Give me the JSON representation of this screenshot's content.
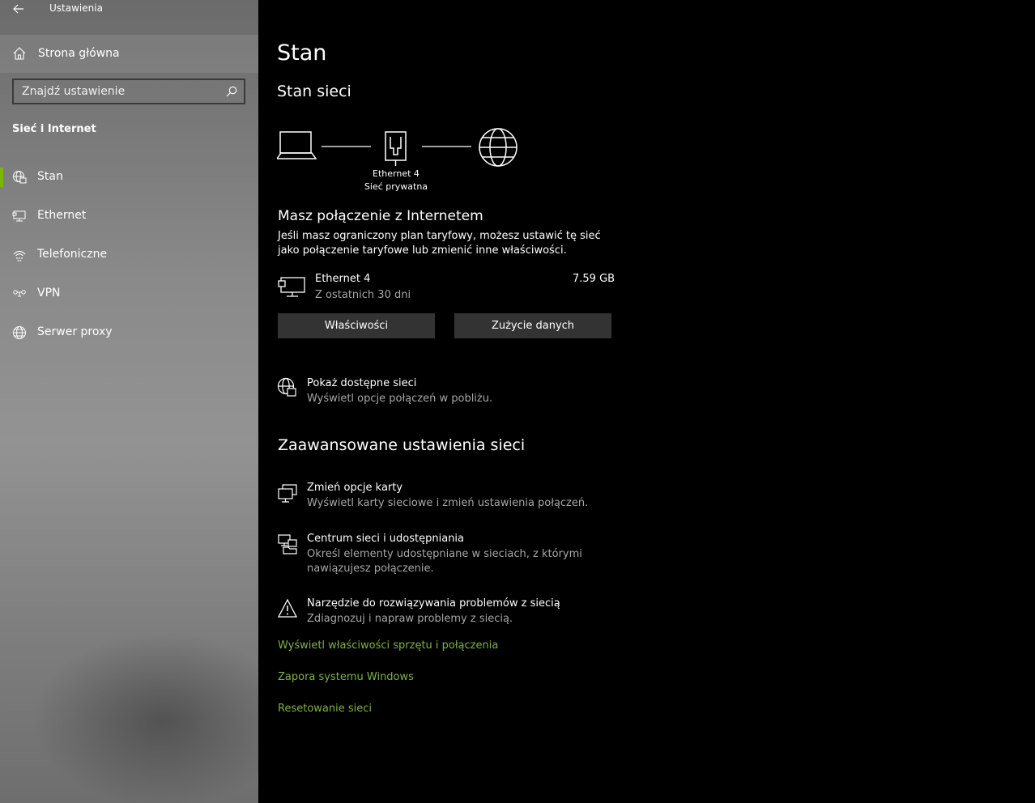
{
  "window": {
    "title": "Ustawienia"
  },
  "sidebar": {
    "home_label": "Strona główna",
    "search_placeholder": "Znajdź ustawienie",
    "section_title": "Sieć i Internet",
    "items": [
      {
        "label": "Stan",
        "icon": "status-globe-icon",
        "active": true
      },
      {
        "label": "Ethernet",
        "icon": "ethernet-monitor-icon",
        "active": false
      },
      {
        "label": "Telefoniczne",
        "icon": "dialup-icon",
        "active": false
      },
      {
        "label": "VPN",
        "icon": "vpn-icon",
        "active": false
      },
      {
        "label": "Serwer proxy",
        "icon": "globe-icon",
        "active": false
      }
    ],
    "accent_color": "#76b900"
  },
  "main": {
    "title": "Stan",
    "subtitle": "Stan sieci",
    "diagram": {
      "adapter_name": "Ethernet 4",
      "network_type": "Sieć prywatna"
    },
    "connection_heading": "Masz połączenie z Internetem",
    "connection_desc": "Jeśli masz ograniczony plan taryfowy, możesz ustawić tę sieć jako połączenie taryfowe lub zmienić inne właściwości.",
    "adapter": {
      "name": "Ethernet 4",
      "period": "Z ostatnich 30 dni",
      "usage": "7.59 GB"
    },
    "buttons": {
      "properties": "Właściwości",
      "data_usage": "Zużycie danych"
    },
    "show_networks": {
      "title": "Pokaż dostępne sieci",
      "desc": "Wyświetl opcje połączeń w pobliżu."
    },
    "advanced_heading": "Zaawansowane ustawienia sieci",
    "advanced_items": [
      {
        "title": "Zmień opcje karty",
        "desc": "Wyświetl karty sieciowe i zmień ustawienia połączeń."
      },
      {
        "title": "Centrum sieci i udostępniania",
        "desc": "Określ elementy udostępniane w sieciach, z którymi nawiązujesz połączenie."
      },
      {
        "title": "Narzędzie do rozwiązywania problemów z siecią",
        "desc": "Zdiagnozuj i napraw problemy z siecią."
      }
    ],
    "links": [
      "Wyświetl właściwości sprzętu i połączenia",
      "Zapora systemu Windows",
      "Resetowanie sieci"
    ],
    "link_color": "#7db343"
  }
}
